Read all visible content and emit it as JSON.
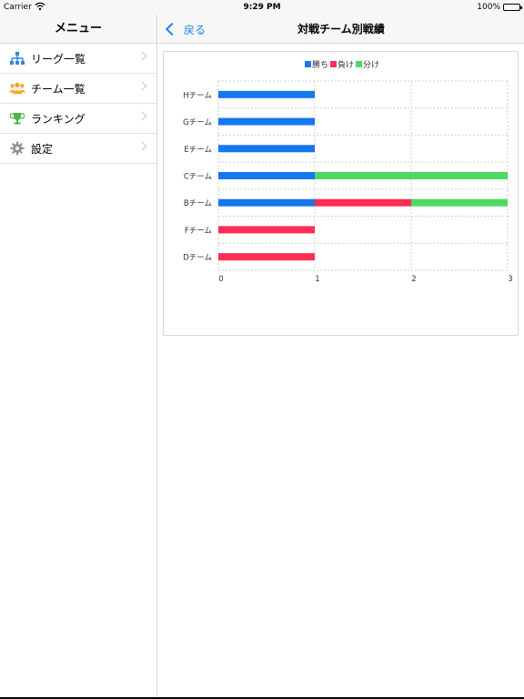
{
  "status_bar": {
    "carrier": "Carrier",
    "time": "9:29 PM",
    "battery": "100%"
  },
  "sidebar": {
    "title": "メニュー",
    "items": [
      {
        "label": "リーグ一覧",
        "icon": "org-chart-icon"
      },
      {
        "label": "チーム一覧",
        "icon": "team-icon"
      },
      {
        "label": "ランキング",
        "icon": "trophy-icon"
      },
      {
        "label": "設定",
        "icon": "gear-icon"
      }
    ]
  },
  "detail": {
    "back_label": "戻る",
    "title": "対戦チーム別戦績"
  },
  "colors": {
    "win": "#1677ee",
    "loss": "#ff2d55",
    "draw": "#4cd964",
    "accent": "#1d82f0"
  },
  "chart_data": {
    "type": "bar",
    "orientation": "horizontal",
    "stacked": true,
    "categories": [
      "Hチーム",
      "Gチーム",
      "Eチーム",
      "Cチーム",
      "Bチーム",
      "Fチーム",
      "Dチーム"
    ],
    "series": [
      {
        "name": "勝ち",
        "color": "#1677ee",
        "values": [
          1,
          1,
          1,
          1,
          1,
          0,
          0
        ]
      },
      {
        "name": "負け",
        "color": "#ff2d55",
        "values": [
          0,
          0,
          0,
          0,
          1,
          1,
          1
        ]
      },
      {
        "name": "分け",
        "color": "#4cd964",
        "values": [
          0,
          0,
          0,
          2,
          1,
          0,
          0
        ]
      }
    ],
    "xlim": [
      0,
      3
    ],
    "xticks": [
      "0",
      "1",
      "2",
      "3"
    ],
    "legend": "top-center",
    "grid": true
  }
}
